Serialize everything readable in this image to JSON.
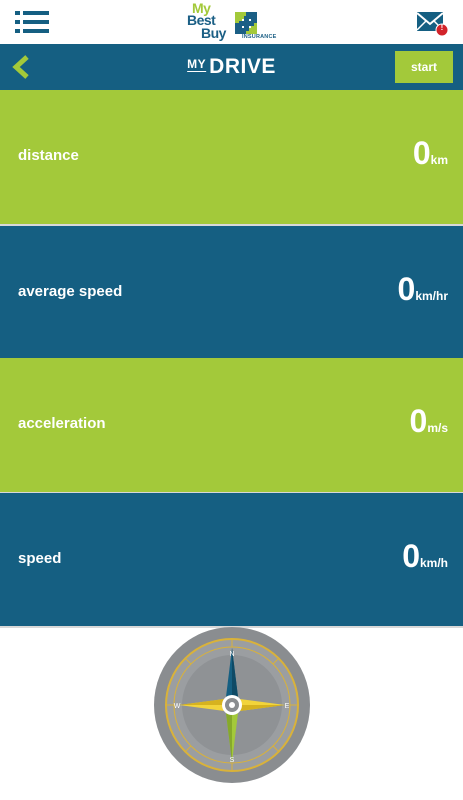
{
  "header": {
    "menu_icon": "hamburger-menu-icon",
    "logo": {
      "line1": "My",
      "line2": "Best",
      "line3": "Buy",
      "tagline": "INSURANCE",
      "colors": {
        "green": "#a3c93a",
        "blue": "#1b5f85"
      }
    },
    "mail_icon": "envelope-icon",
    "notification_badge": "!"
  },
  "navbar": {
    "back_icon": "chevron-left-icon",
    "title_prefix": "MY",
    "title": "DRIVE",
    "start_label": "start"
  },
  "metrics": [
    {
      "label": "distance",
      "value": "0",
      "unit": "km",
      "color": "#a3c93a"
    },
    {
      "label": "average speed",
      "value": "0",
      "unit": "km/hr",
      "color": "#155f82"
    },
    {
      "label": "acceleration",
      "value": "0",
      "unit": "m/s",
      "color": "#a3c93a"
    },
    {
      "label": "speed",
      "value": "0",
      "unit": "km/h",
      "color": "#155f82"
    }
  ],
  "compass": {
    "icon": "compass-icon",
    "labels": {
      "north": "N",
      "east": "E",
      "south": "S",
      "west": "W"
    }
  },
  "theme": {
    "primary_blue": "#155f82",
    "accent_green": "#a3c93a",
    "badge_red": "#d2232a"
  }
}
